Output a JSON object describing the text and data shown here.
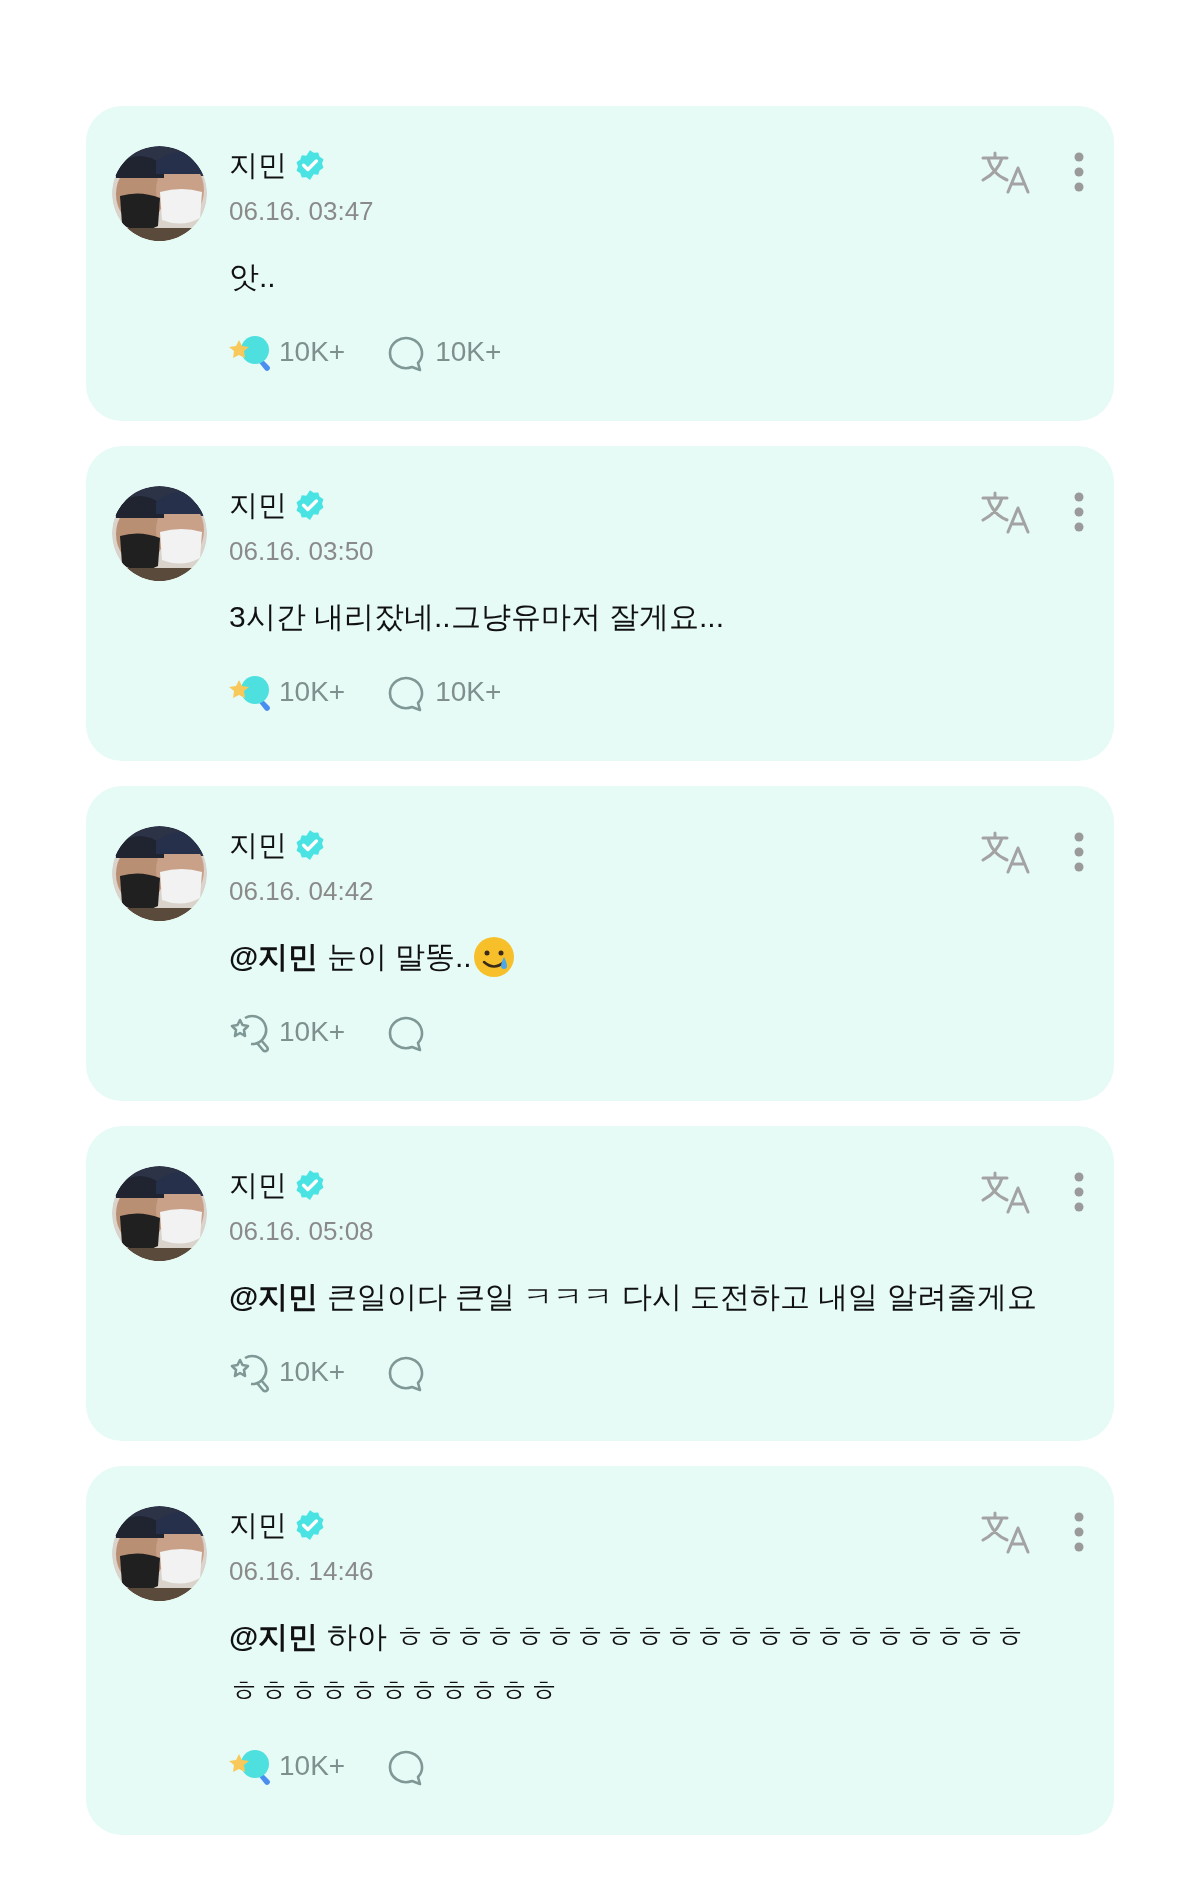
{
  "posts": [
    {
      "author": "지민",
      "verified": true,
      "time": "06.16. 03:47",
      "text": "앗..",
      "liked": true,
      "like_count": "10K+",
      "comment_count": "10K+"
    },
    {
      "author": "지민",
      "verified": true,
      "time": "06.16. 03:50",
      "text": "3시간 내리잤네..그냥유마저 잘게요...",
      "liked": true,
      "like_count": "10K+",
      "comment_count": "10K+"
    },
    {
      "author": "지민",
      "verified": true,
      "time": "06.16. 04:42",
      "text": "**@지민** 눈이 말똥..",
      "trailing_icon": {
        "kind": "smiling_tear"
      },
      "liked": false,
      "like_count": "10K+"
    },
    {
      "author": "지민",
      "verified": true,
      "time": "06.16. 05:08",
      "text": "**@지민** 큰일이다 큰일 ㅋㅋㅋ 다시 도전하고 내일 알려줄게요",
      "liked": false,
      "like_count": "10K+"
    },
    {
      "author": "지민",
      "verified": true,
      "time": "06.16. 14:46",
      "text": "**@지민** 하아 ㅎㅎㅎㅎㅎㅎㅎㅎㅎㅎㅎㅎㅎㅎㅎㅎㅎㅎㅎㅎㅎㅎㅎㅎㅎㅎㅎㅎㅎㅎㅎㅎ",
      "liked": true,
      "like_count": "10K+"
    }
  ]
}
